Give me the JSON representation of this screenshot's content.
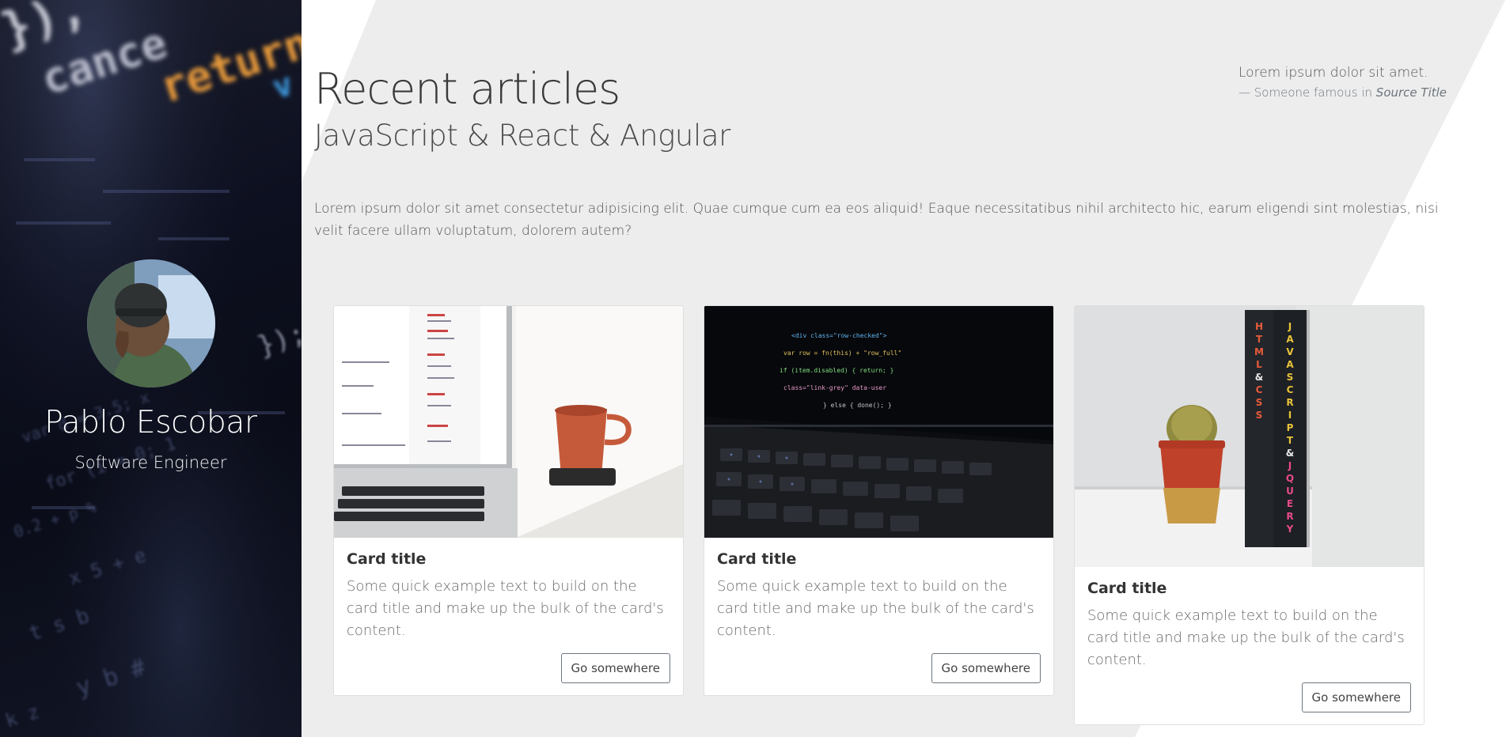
{
  "profile": {
    "name": "Pablo Escobar",
    "title": "Software Engineer"
  },
  "header": {
    "title": "Recent articles",
    "subtitle": "JavaScript & React & Angular"
  },
  "quote": {
    "text": "Lorem ipsum dolor sit amet.",
    "dash": "— ",
    "footer_prefix": "Someone famous in ",
    "source": "Source Title"
  },
  "intro": "Lorem ipsum dolor sit amet consectetur adipisicing elit. Quae cumque cum ea eos aliquid! Eaque necessitatibus nihil architecto hic, earum eligendi sint molestias, nisi velit facere ullam voluptatum, dolorem autem?",
  "cards": [
    {
      "image": "laptop-coffee-cup-photo",
      "title": "Card title",
      "text": "Some quick example text to build on the card title and make up the bulk of the card's content.",
      "button": "Go somewhere"
    },
    {
      "image": "laptop-code-keyboard-photo",
      "title": "Card title",
      "text": "Some quick example text to build on the card title and make up the bulk of the card's content.",
      "button": "Go somewhere"
    },
    {
      "image": "cactus-books-photo",
      "title": "Card title",
      "text": "Some quick example text to build on the card title and make up the bulk of the card's content.",
      "button": "Go somewhere"
    }
  ],
  "colors": {
    "sidebar_bg": "#0d1020",
    "main_bg": "#ededed",
    "accent_text": "#3a3a3a"
  }
}
